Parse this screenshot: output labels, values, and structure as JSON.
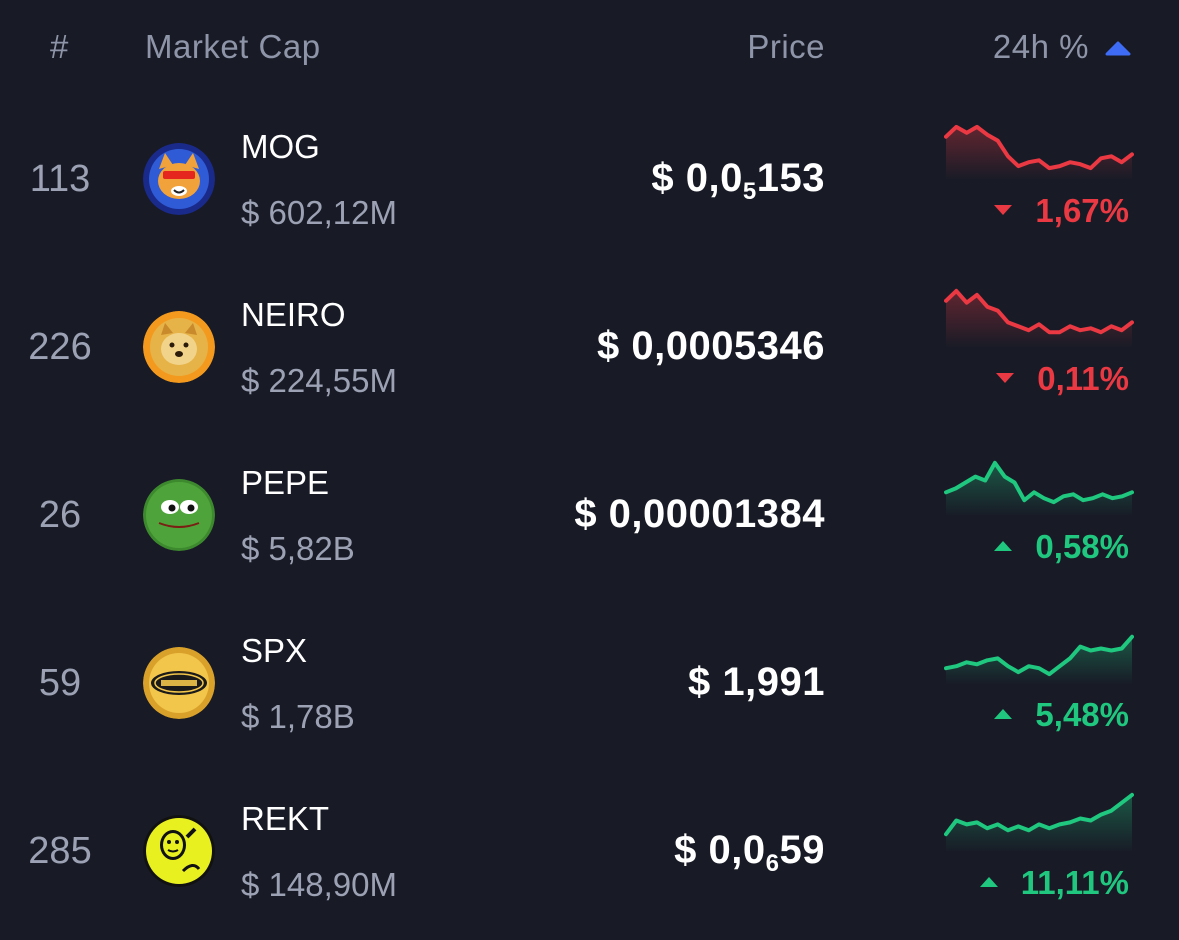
{
  "header": {
    "rank": "#",
    "market_cap": "Market Cap",
    "price": "Price",
    "change": "24h %"
  },
  "colors": {
    "background": "#181b26",
    "up": "#1fc77f",
    "down": "#ea3943",
    "muted": "#9ca2b4",
    "accent": "#3e6cf4"
  },
  "coins": [
    {
      "rank": "113",
      "name": "MOG",
      "market_cap": "$ 602,12M",
      "price_prefix": "$ 0,0",
      "price_sub": "5",
      "price_suffix": "153",
      "change": "1,67%",
      "direction": "down",
      "icon": "mog-cat-icon",
      "spark": [
        78,
        88,
        82,
        88,
        80,
        74,
        58,
        48,
        52,
        54,
        46,
        48,
        52,
        50,
        46,
        56,
        58,
        52,
        60
      ]
    },
    {
      "rank": "226",
      "name": "NEIRO",
      "market_cap": "$ 224,55M",
      "price_prefix": "$ 0,0005346",
      "price_sub": "",
      "price_suffix": "",
      "change": "0,11%",
      "direction": "down",
      "icon": "neiro-dog-icon",
      "spark": [
        82,
        92,
        80,
        88,
        76,
        72,
        60,
        56,
        52,
        58,
        50,
        50,
        56,
        52,
        54,
        50,
        56,
        52,
        60
      ]
    },
    {
      "rank": "26",
      "name": "PEPE",
      "market_cap": "$ 5,82B",
      "price_prefix": "$ 0,00001384",
      "price_sub": "",
      "price_suffix": "",
      "change": "0,58%",
      "direction": "up",
      "icon": "pepe-frog-icon",
      "spark": [
        58,
        62,
        68,
        74,
        70,
        88,
        74,
        68,
        50,
        58,
        52,
        48,
        54,
        56,
        50,
        52,
        56,
        52,
        54,
        58
      ]
    },
    {
      "rank": "59",
      "name": "SPX",
      "market_cap": "$ 1,78B",
      "price_prefix": "$ 1,991",
      "price_sub": "",
      "price_suffix": "",
      "change": "5,48%",
      "direction": "up",
      "icon": "spx6900-coin-icon",
      "spark": [
        50,
        52,
        56,
        54,
        58,
        60,
        52,
        46,
        52,
        50,
        44,
        52,
        60,
        72,
        68,
        70,
        68,
        70,
        82
      ]
    },
    {
      "rank": "285",
      "name": "REKT",
      "market_cap": "$ 148,90M",
      "price_prefix": "$ 0,0",
      "price_sub": "6",
      "price_suffix": "59",
      "change": "11,11%",
      "direction": "up",
      "icon": "rekt-character-icon",
      "spark": [
        52,
        66,
        62,
        64,
        58,
        62,
        56,
        60,
        56,
        62,
        58,
        62,
        64,
        68,
        66,
        72,
        76,
        84,
        92
      ]
    }
  ]
}
